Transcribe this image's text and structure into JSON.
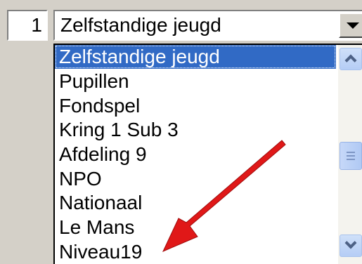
{
  "row": {
    "number": "1"
  },
  "combo": {
    "selected_value": "Zelfstandige jeugd"
  },
  "dropdown": {
    "items": [
      {
        "label": "Zelfstandige jeugd",
        "selected": true
      },
      {
        "label": "Pupillen",
        "selected": false
      },
      {
        "label": "Fondspel",
        "selected": false
      },
      {
        "label": "Kring 1 Sub 3",
        "selected": false
      },
      {
        "label": "Afdeling 9",
        "selected": false
      },
      {
        "label": "NPO",
        "selected": false
      },
      {
        "label": "Nationaal",
        "selected": false
      },
      {
        "label": "Le Mans",
        "selected": false
      },
      {
        "label": "Niveau19",
        "selected": false
      }
    ]
  },
  "colors": {
    "selection": "#316ac5",
    "annotation_arrow": "#e01818"
  },
  "icons": {
    "combo_button": "chevron-down-icon",
    "scroll_up": "chevron-up-icon",
    "scroll_down": "chevron-down-icon",
    "annotation": "red-arrow-icon"
  }
}
